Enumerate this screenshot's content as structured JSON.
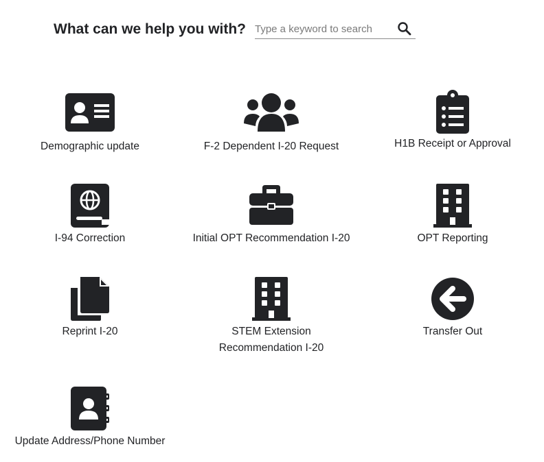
{
  "header": {
    "title": "What can we help you with?",
    "search_placeholder": "Type a keyword to search"
  },
  "tiles": [
    {
      "label": "Demographic update",
      "icon": "id-card-icon"
    },
    {
      "label": "F-2 Dependent I-20 Request",
      "icon": "users-icon"
    },
    {
      "label": "H1B Receipt or Approval",
      "icon": "clipboard-list-icon"
    },
    {
      "label": "I-94 Correction",
      "icon": "passport-icon"
    },
    {
      "label": "Initial OPT Recommendation I-20",
      "icon": "briefcase-icon"
    },
    {
      "label": "OPT Reporting",
      "icon": "building-icon"
    },
    {
      "label": "Reprint I-20",
      "icon": "copy-icon"
    },
    {
      "label_line1": "STEM Extension",
      "label_line2": "Recommendation I-20",
      "icon": "building-icon"
    },
    {
      "label": "Transfer Out",
      "icon": "arrow-circle-left-icon"
    },
    {
      "label": "Update Address/Phone Number",
      "icon": "address-book-icon"
    }
  ],
  "colors": {
    "icon": "#222326",
    "text": "#222326",
    "underline": "#8a8a8a"
  }
}
